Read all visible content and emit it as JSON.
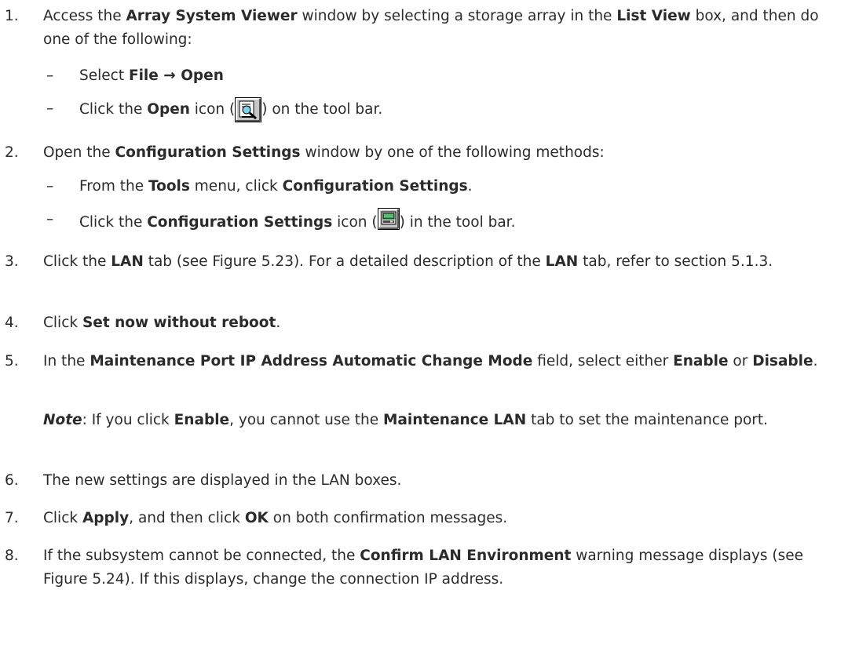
{
  "steps": [
    {
      "number": "1.",
      "text_1": "Access the ",
      "bold_1": "Array System Viewer",
      "text_2": " window by selecting a storage array in the ",
      "bold_2": "List View",
      "text_3": " box, and then do one of the following:",
      "subitems": [
        {
          "dash": "–",
          "text_1": "Select ",
          "bold_1": "File → Open"
        },
        {
          "dash": "–",
          "text_1": "Click the ",
          "bold_1": "Open",
          "text_2": " icon (",
          "icon": "open-search-icon",
          "text_3": ") on the tool bar."
        }
      ]
    },
    {
      "number": "2.",
      "text_1": "Open the ",
      "bold_1": "Configuration Settings",
      "text_2": " window by one of the following methods:",
      "subitems": [
        {
          "dash": "–",
          "text_1": "From the ",
          "bold_1": "Tools",
          "text_2": " menu, click ",
          "bold_2": "Configuration Settings",
          "text_3": "."
        },
        {
          "dash": "–",
          "text_1": "Click the ",
          "bold_1": "Configuration Settings",
          "text_2": " icon (",
          "icon": "configuration-settings-icon",
          "text_3": ") in the tool bar."
        }
      ]
    },
    {
      "number": "3.",
      "text_1": "Click the ",
      "bold_1": "LAN",
      "text_2": " tab (see Figure 5.23). For a detailed description of the ",
      "bold_2": "LAN",
      "text_3": " tab, refer to section 5.1.3."
    },
    {
      "number": "4.",
      "text_1": "Click ",
      "bold_1": "Set now without reboot",
      "text_2": "."
    },
    {
      "number": "5.",
      "text_1": "In the ",
      "bold_1": "Maintenance Port IP Address Automatic Change Mode",
      "text_2": " field, select either ",
      "bold_2": "Enable",
      "text_3": " or ",
      "bold_3": "Disable",
      "text_4": ".",
      "note": {
        "label": "Note",
        "text_1": ": If you click ",
        "bold_1": "Enable",
        "text_2": ", you cannot use the ",
        "bold_2": "Maintenance LAN",
        "text_3": " tab to set the maintenance port."
      }
    },
    {
      "number": "6.",
      "text_1": "The new settings are displayed in the LAN boxes."
    },
    {
      "number": "7.",
      "text_1": "Click ",
      "bold_1": "Apply",
      "text_2": ", and then click ",
      "bold_2": "OK",
      "text_3": " on both confirmation messages."
    },
    {
      "number": "8.",
      "text_1": "If the subsystem cannot be connected, the ",
      "bold_1": "Confirm LAN Environment",
      "text_2": " warning message displays (see Figure 5.24). If this displays, change the connection IP address."
    }
  ]
}
